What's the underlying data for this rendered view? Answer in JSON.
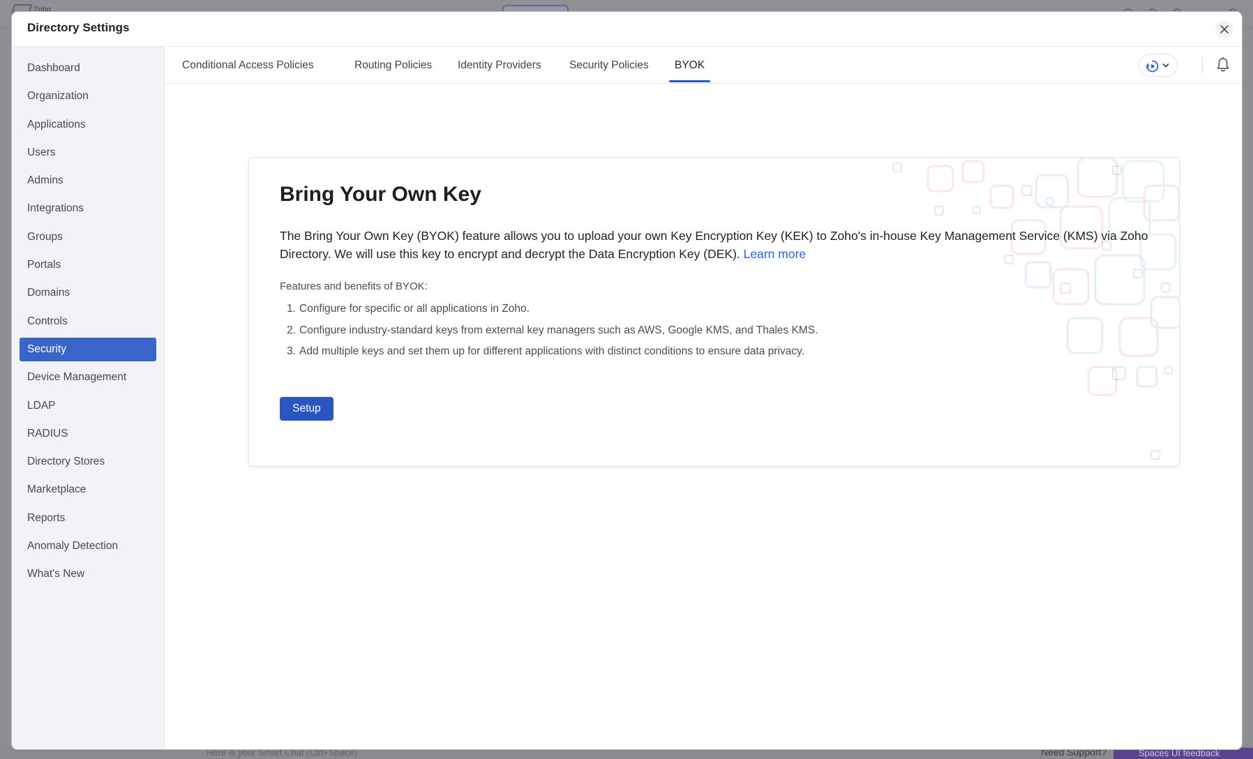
{
  "background": {
    "logo_text": "Zoho",
    "smart_chat_placeholder": "Here is your Smart Chat (Ctrl+Space)",
    "need_support": "Need Support?",
    "feedback": "Spaces UI feedback"
  },
  "modal": {
    "title": "Directory Settings"
  },
  "sidebar": {
    "items": [
      {
        "label": "Dashboard"
      },
      {
        "label": "Organization"
      },
      {
        "label": "Applications"
      },
      {
        "label": "Users"
      },
      {
        "label": "Admins"
      },
      {
        "label": "Integrations"
      },
      {
        "label": "Groups"
      },
      {
        "label": "Portals"
      },
      {
        "label": "Domains"
      },
      {
        "label": "Controls"
      },
      {
        "label": "Security",
        "active": true
      },
      {
        "label": "Device Management"
      },
      {
        "label": "LDAP"
      },
      {
        "label": "RADIUS"
      },
      {
        "label": "Directory Stores"
      },
      {
        "label": "Marketplace"
      },
      {
        "label": "Reports"
      },
      {
        "label": "Anomaly Detection"
      },
      {
        "label": "What's New"
      }
    ]
  },
  "tabs": [
    {
      "label": "Conditional Access Policies"
    },
    {
      "label": "Routing Policies"
    },
    {
      "label": "Identity Providers"
    },
    {
      "label": "Security Policies"
    },
    {
      "label": "BYOK",
      "active": true
    }
  ],
  "card": {
    "title": "Bring Your Own Key",
    "description": "The Bring Your Own Key (BYOK) feature allows you to upload your own Key Encryption Key (KEK) to Zoho's in-house Key Management Service (KMS) via Zoho Directory. We will use this key to encrypt and decrypt the Data Encryption Key (DEK).",
    "learn_more": "Learn more",
    "features_heading": "Features and benefits of BYOK:",
    "features": [
      {
        "num": "1.",
        "text": "Configure for specific or all applications in Zoho."
      },
      {
        "num": "2.",
        "text": "Configure industry-standard keys from external key managers such as AWS, Google KMS, and Thales KMS."
      },
      {
        "num": "3.",
        "text": "Add multiple keys and set them up for different applications with distinct conditions to ensure data privacy."
      }
    ],
    "setup_label": "Setup"
  },
  "colors": {
    "accent": "#2b55c0",
    "sidebar_active": "#3965c9",
    "link": "#2a62d6",
    "sidebar_bg": "#f2f3f7",
    "overlay": "#8e8f93"
  },
  "icons": {
    "close": "close-icon",
    "play": "play-icon",
    "chevron": "chevron-down-icon",
    "bell": "bell-icon"
  }
}
